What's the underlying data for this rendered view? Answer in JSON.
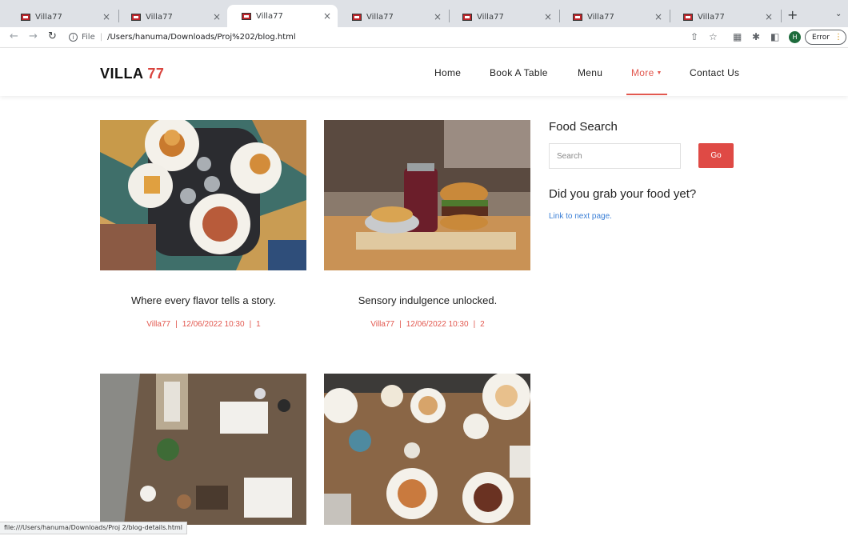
{
  "browser": {
    "tabs": [
      {
        "title": "Villa77",
        "active": false
      },
      {
        "title": "Villa77",
        "active": false
      },
      {
        "title": "Villa77",
        "active": true
      },
      {
        "title": "Villa77",
        "active": false
      },
      {
        "title": "Villa77",
        "active": false
      },
      {
        "title": "Villa77",
        "active": false
      },
      {
        "title": "Villa77",
        "active": false
      }
    ],
    "tab_close_glyph": "×",
    "new_tab_glyph": "+",
    "file_label": "File",
    "url": "/Users/hanuma/Downloads/Proj%202/blog.html",
    "profile_initial": "H",
    "error_label": "Error",
    "status_url": "file:///Users/hanuma/Downloads/Proj 2/blog-details.html"
  },
  "site": {
    "brand_name": "VILLA",
    "brand_number": "77",
    "accent_color": "#e2584f",
    "nav": {
      "home": "Home",
      "book": "Book A Table",
      "menu": "Menu",
      "more": "More",
      "contact": "Contact Us"
    }
  },
  "posts": [
    {
      "title": "Where every flavor tells a story.",
      "author": "Villa77",
      "datetime": "12/06/2022 10:30",
      "comments": "1"
    },
    {
      "title": "Sensory indulgence unlocked.",
      "author": "Villa77",
      "datetime": "12/06/2022 10:30",
      "comments": "2"
    }
  ],
  "sidebar": {
    "search_heading": "Food Search",
    "search_placeholder": "Search",
    "go_label": "Go",
    "promo_heading": "Did you grab your food yet?",
    "next_link": "Link to next page."
  }
}
